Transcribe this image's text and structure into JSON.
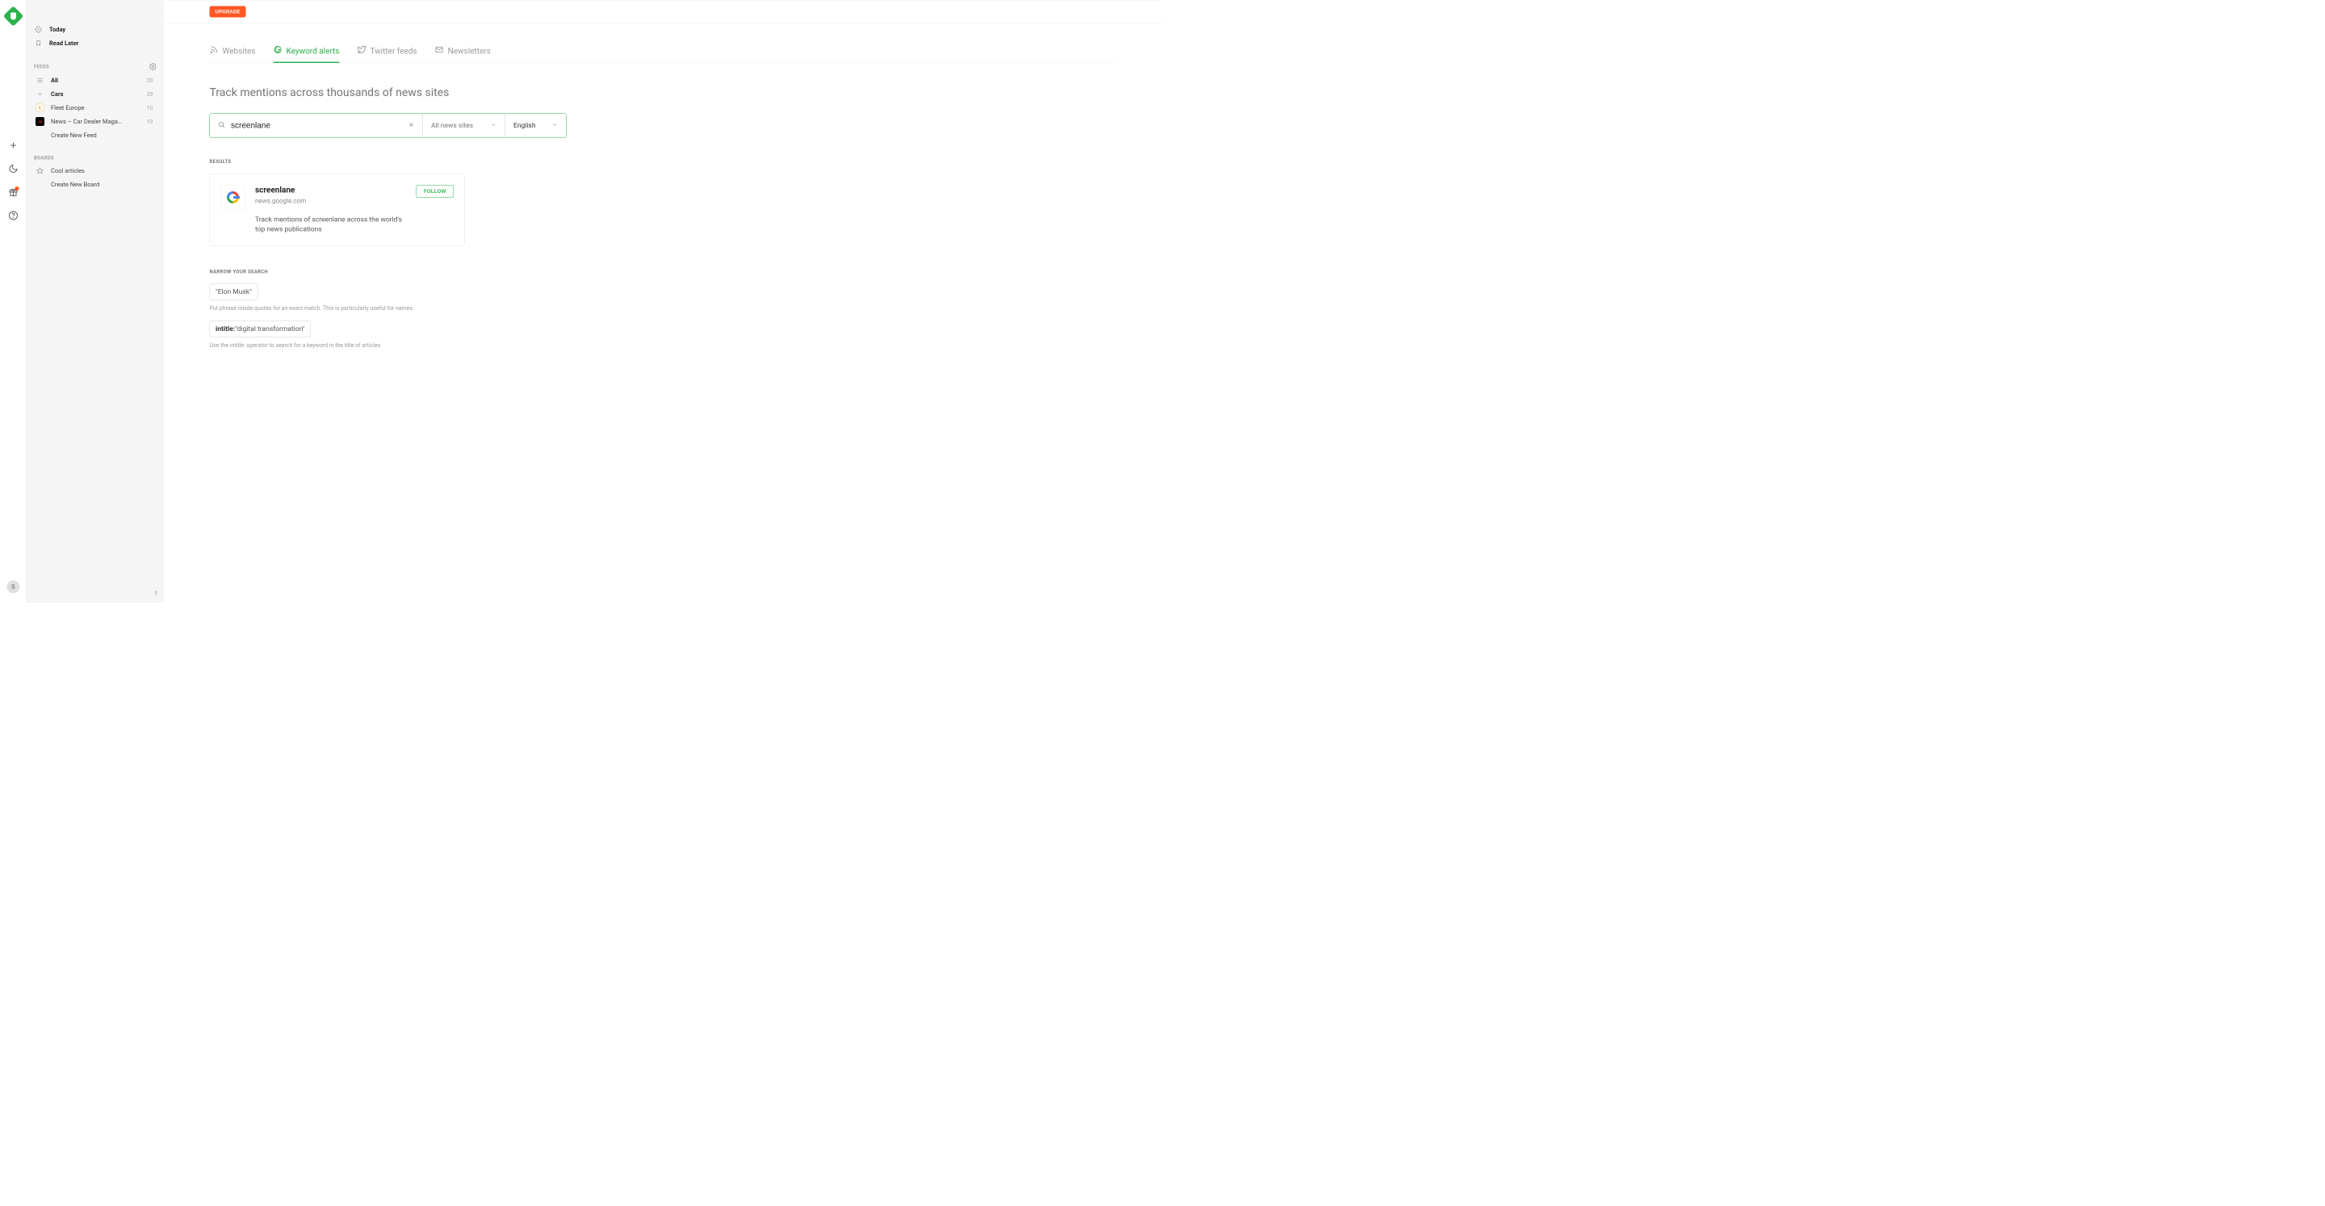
{
  "rail": {
    "avatar_initial": "S"
  },
  "sidebar": {
    "today": "Today",
    "read_later": "Read Later",
    "feeds_header": "FEEDS",
    "all": {
      "label": "All",
      "count": "20"
    },
    "cars": {
      "label": "Cars",
      "count": "20"
    },
    "feeds": [
      {
        "label": "Fleet Europe",
        "count": "10"
      },
      {
        "label": "News – Car Dealer Maga…",
        "count": "10"
      }
    ],
    "create_feed": "Create New Feed",
    "boards_header": "BOARDS",
    "boards": [
      {
        "label": "Cool articles"
      }
    ],
    "create_board": "Create New Board"
  },
  "header": {
    "upgrade": "UPGRADE"
  },
  "tabs": {
    "websites": "Websites",
    "keyword": "Keyword alerts",
    "twitter": "Twitter feeds",
    "newsletters": "Newsletters"
  },
  "heading": "Track mentions across thousands of news sites",
  "search": {
    "value": "screenlane",
    "source": "All news sites",
    "language": "English"
  },
  "results": {
    "label": "RESULTS",
    "card": {
      "title": "screenlane",
      "domain": "news.google.com",
      "desc": "Track mentions of screenlane across the world's top news publications",
      "follow": "FOLLOW"
    }
  },
  "narrow": {
    "label": "NARROW YOUR SEARCH",
    "s1": "\"Elon Musk\"",
    "h1": "Put phrase inside quotes for an exact match. This is particularly useful for names.",
    "s2_prefix": "intitle:",
    "s2_rest": "\"digital transformation\"",
    "h2": "Use the intitle: operator to search for a keyword in the title of articles"
  }
}
